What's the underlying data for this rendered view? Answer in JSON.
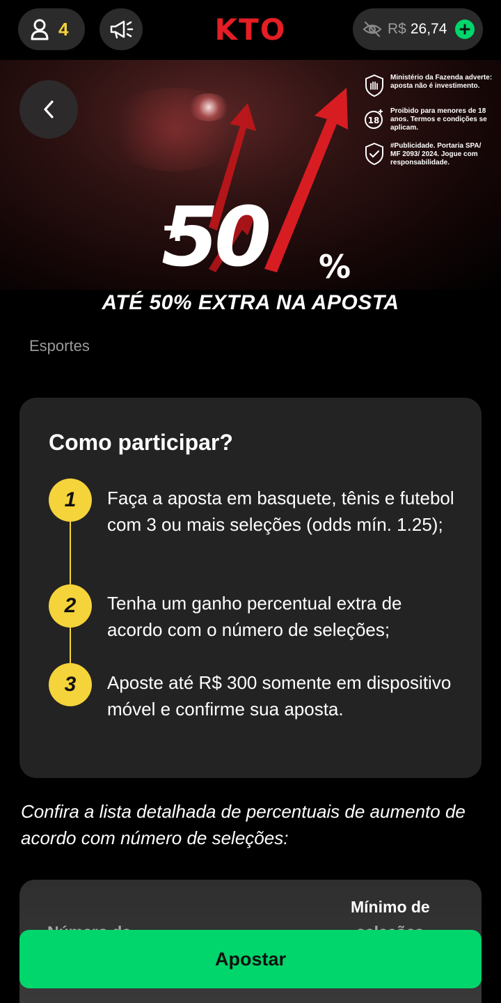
{
  "header": {
    "user_count": "4",
    "logo_text": "KTO",
    "balance_currency": "R$",
    "balance_amount": "26,74"
  },
  "banner": {
    "big_number": "50",
    "plus": "+",
    "percent": "%",
    "disclaimers": [
      {
        "icon": "hand-shield-icon",
        "text": "Ministério da Fazenda adverte: aposta não é investimento."
      },
      {
        "icon": "age-18-icon",
        "text": "Proibido para menores de 18 anos. Termos e condições se aplicam."
      },
      {
        "icon": "shield-check-icon",
        "text": "#Publicidade. Portaria SPA/ MF 2093/ 2024. Jogue com responsabilidade."
      }
    ]
  },
  "promo": {
    "title": "ATÉ 50% EXTRA NA APOSTA",
    "category": "Esportes"
  },
  "steps_card": {
    "title": "Como participar?",
    "steps": [
      {
        "number": "1",
        "text": "Faça a aposta em basquete, tênis e futebol com 3 ou mais seleções (odds mín. 1.25);"
      },
      {
        "number": "2",
        "text": "Tenha um ganho percentual extra de acordo com o número de seleções;"
      },
      {
        "number": "3",
        "text": "Aposte até R$ 300 somente em dispositivo móvel e confirme sua aposta."
      }
    ]
  },
  "intro_text": "Confira a lista detalhada de percentuais de aumento de acordo com número de seleções:",
  "table": {
    "col_left": "Número de",
    "col_right_line1": "Mínimo de",
    "col_right_line2": "seleções"
  },
  "cta": {
    "label": "Apostar"
  },
  "colors": {
    "accent_yellow": "#f5d33a",
    "brand_red": "#e31e24",
    "cta_green": "#00d66b"
  }
}
